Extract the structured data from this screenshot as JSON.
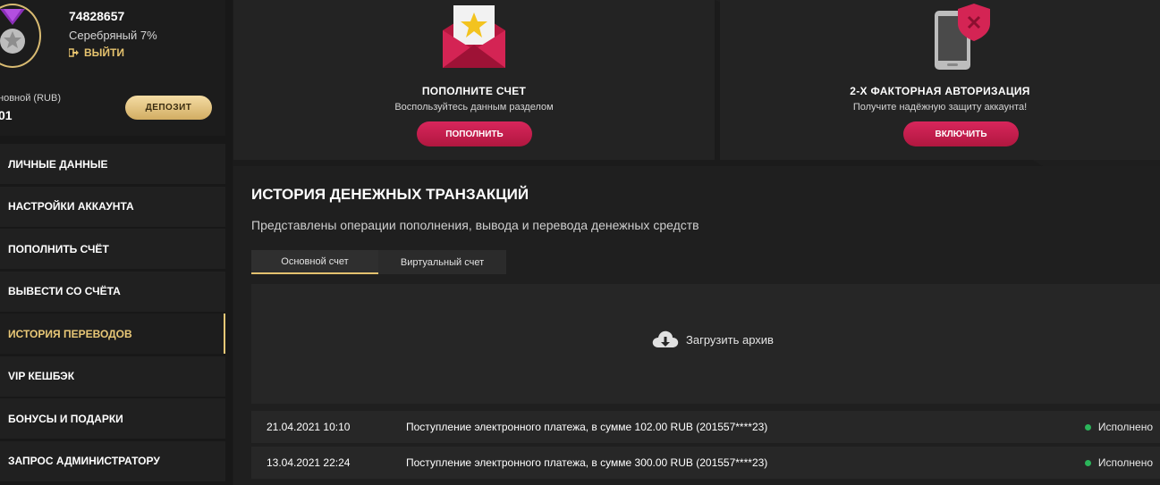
{
  "profile": {
    "user_id": "74828657",
    "level": "Серебряный 7%",
    "logout_label": "ВЫЙТИ",
    "balance_label": "новной (RUB)",
    "balance_value": "01",
    "deposit_label": "ДЕПОЗИТ"
  },
  "menu": {
    "items": [
      {
        "label": "ЛИЧНЫЕ ДАННЫЕ"
      },
      {
        "label": "НАСТРОЙКИ АККАУНТА"
      },
      {
        "label": "ПОПОЛНИТЬ СЧЁТ"
      },
      {
        "label": "ВЫВЕСТИ СО СЧЁТА"
      },
      {
        "label": "ИСТОРИЯ ПЕРЕВОДОВ"
      },
      {
        "label": "VIP КЕШБЭК"
      },
      {
        "label": "БОНУСЫ И ПОДАРКИ"
      },
      {
        "label": "ЗАПРОС АДМИНИСТРАТОРУ"
      }
    ],
    "active_index": 4
  },
  "cards": {
    "deposit": {
      "title": "ПОПОЛНИТЕ СЧЕТ",
      "subtitle": "Воспользуйтесь данным разделом",
      "button": "ПОПОЛНИТЬ",
      "icon": "envelope-star-icon"
    },
    "twofa": {
      "title": "2-Х ФАКТОРНАЯ АВТОРИЗАЦИЯ",
      "subtitle": "Получите надёжную защиту аккаунта!",
      "button": "ВКЛЮЧИТЬ",
      "icon": "phone-shield-icon"
    }
  },
  "history": {
    "title": "ИСТОРИЯ ДЕНЕЖНЫХ ТРАНЗАКЦИЙ",
    "subtitle": "Представлены операции пополнения, вывода и перевода денежных средств",
    "tabs": [
      {
        "label": "Основной счет"
      },
      {
        "label": "Виртуальный счет"
      }
    ],
    "archive_label": "Загрузить архив",
    "transactions": [
      {
        "date": "21.04.2021 10:10",
        "description": "Поступление электронного платежа, в сумме 102.00 RUB (201557****23)",
        "status": "Исполнено"
      },
      {
        "date": "13.04.2021 22:24",
        "description": "Поступление электронного платежа, в сумме 300.00 RUB (201557****23)",
        "status": "Исполнено"
      }
    ]
  },
  "colors": {
    "accent_gold": "#e9c877",
    "accent_red": "#c81d4c",
    "status_green": "#2bb55a",
    "background": "#1b1b1b"
  }
}
